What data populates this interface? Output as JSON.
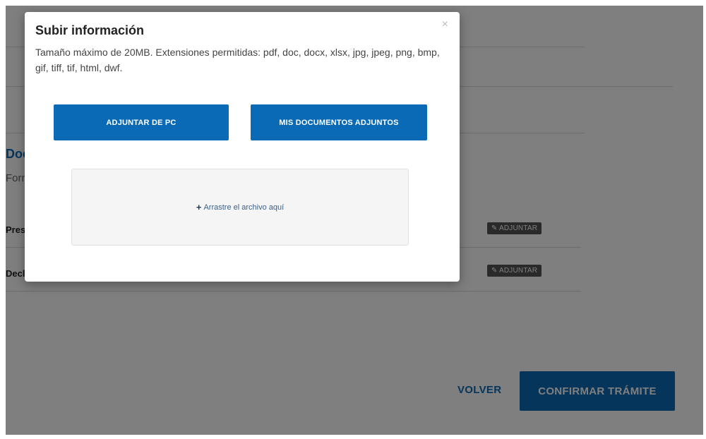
{
  "background": {
    "section_heading": "Documen",
    "section_subtitle": "Formul",
    "rows": [
      {
        "label": "Presentaci",
        "attach_label": "✎ ADJUNTAR"
      },
      {
        "label": "Declaración A",
        "attach_label": "✎ ADJUNTAR"
      }
    ],
    "back_label": "VOLVER",
    "confirm_label": "CONFIRMAR TRÁMITE"
  },
  "modal": {
    "title": "Subir información",
    "description": "Tamaño máximo de 20MB. Extensiones permitidas: pdf, doc, docx, xlsx, jpg, jpeg, png, bmp, gif, tiff, tif, html, dwf.",
    "close_symbol": "×",
    "attach_pc_label": "ADJUNTAR DE PC",
    "my_docs_label": "MIS DOCUMENTOS ADJUNTOS",
    "dropzone_plus": "+",
    "dropzone_text": "Arrastre el archivo aquí"
  },
  "colors": {
    "primary": "#0a6ab6",
    "overlay": "rgba(0,0,0,0.5)",
    "badge": "#555555"
  }
}
